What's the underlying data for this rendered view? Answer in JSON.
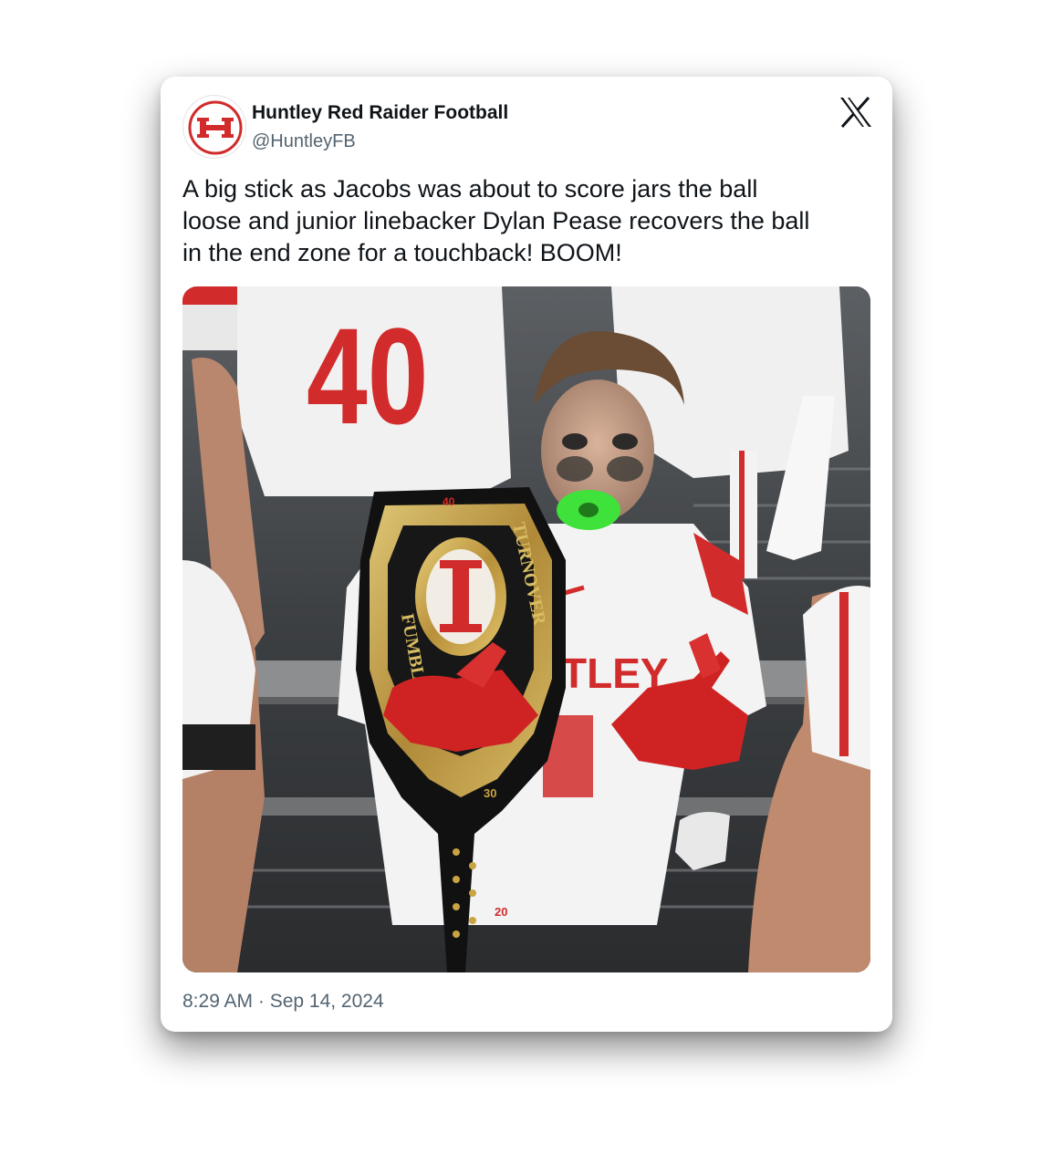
{
  "tweet": {
    "author_name": "Huntley Red Raider Football",
    "author_handle": "@HuntleyFB",
    "avatar_icon": "huntley-h-logo-icon",
    "platform_icon": "x-logo-icon",
    "text": "A big stick as Jacobs was about to score jars the ball\nloose and junior linebacker Dylan Pease recovers the ball\nin the end zone for a touchback! BOOM!",
    "timestamp": "8:29 AM · Sep 14, 2024"
  },
  "photo": {
    "jersey_number_background": "40",
    "belt_text_left": "FUMBLE|INT",
    "belt_text_right": "TURNOVER",
    "jersey_chest_text": "TLEY",
    "belt_numbers": [
      "40",
      "30",
      "20"
    ]
  },
  "colors": {
    "brand_red": "#d12b2b",
    "text_primary": "#0f1419",
    "text_secondary": "#536471",
    "mouthguard_green": "#3fe23a",
    "belt_gold": "#c9a441"
  }
}
